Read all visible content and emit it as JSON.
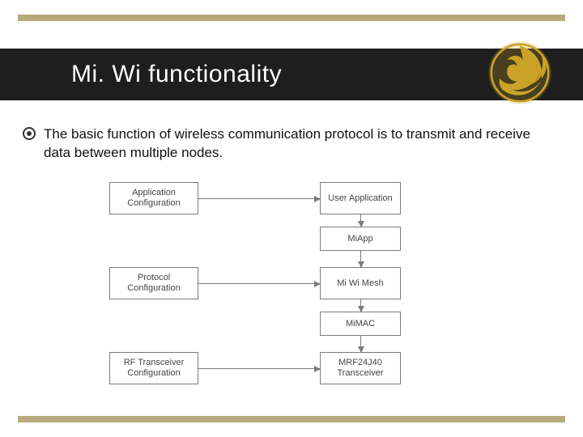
{
  "title": "Mi. Wi functionality",
  "bullet": "The basic function of wireless communication protocol is to transmit and receive data between multiple nodes.",
  "colors": {
    "accent": "#b7aa7c",
    "barbg": "#1e1e1e",
    "box_border": "#7b7b7b"
  },
  "diagram": {
    "left": [
      "Application Configuration",
      "Protocol Configuration",
      "RF Transceiver Configuration"
    ],
    "right": [
      "User Application",
      "MiApp",
      "Mi Wi Mesh",
      "MiMAC",
      "MRF24J40 Transceiver"
    ]
  }
}
